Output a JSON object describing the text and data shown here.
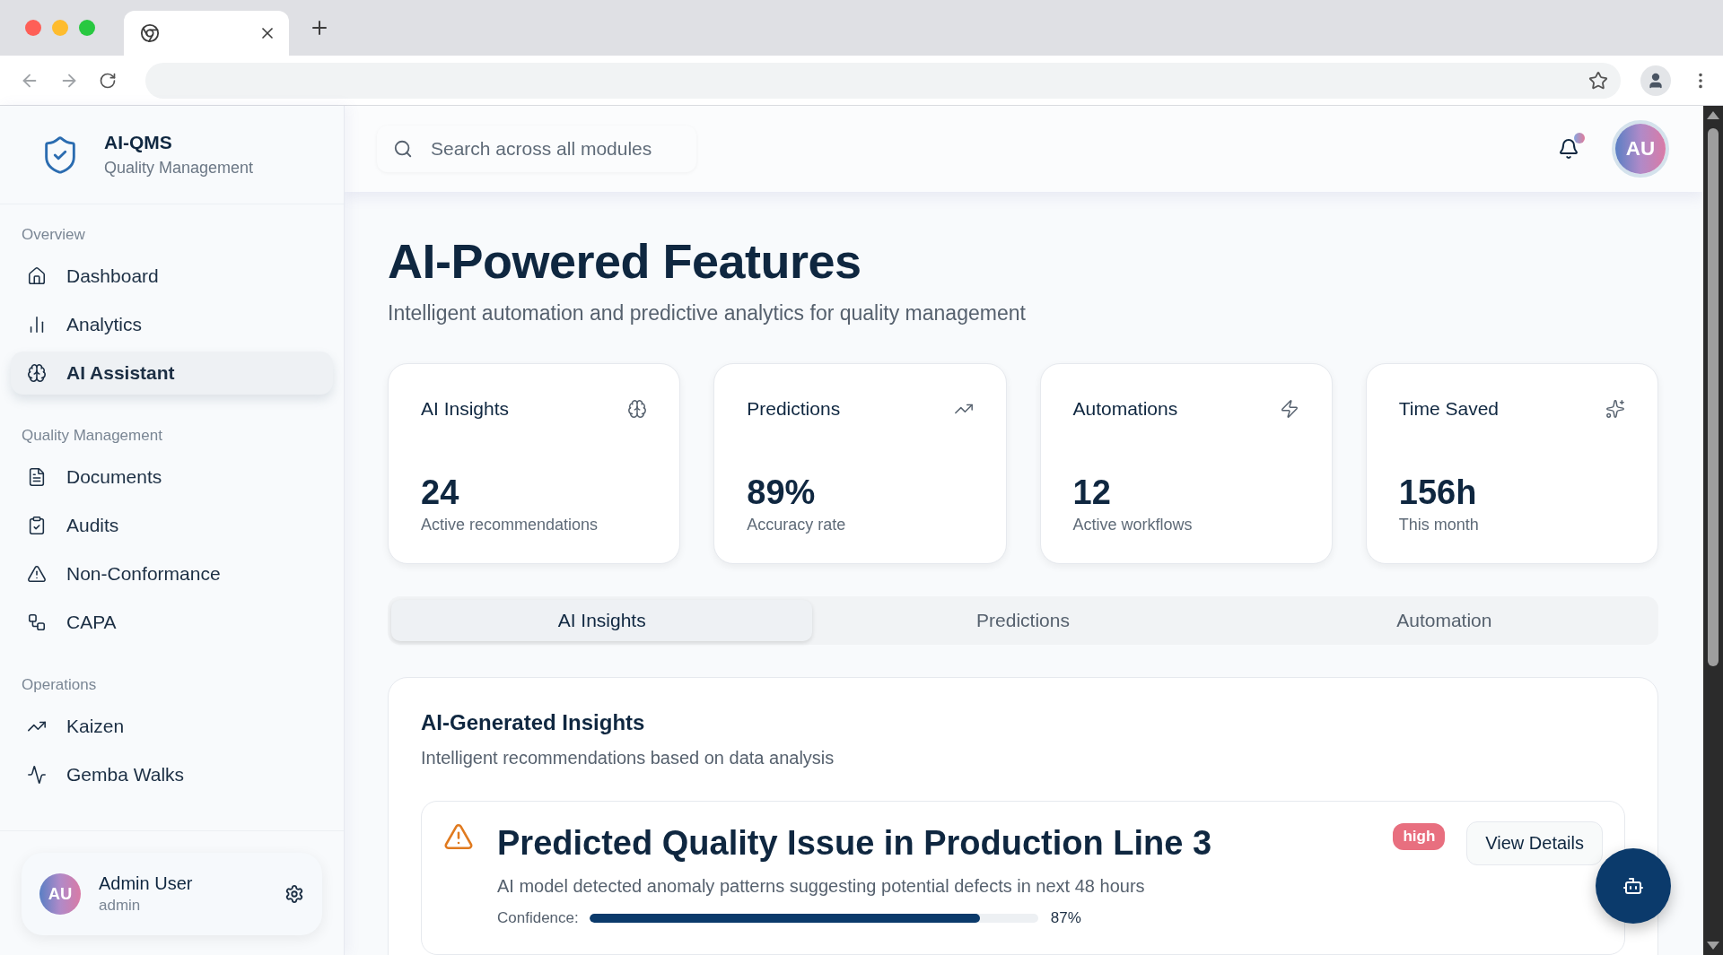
{
  "brand": {
    "name": "AI-QMS",
    "subtitle": "Quality Management"
  },
  "sidebar": {
    "sections": [
      {
        "label": "Overview",
        "items": [
          {
            "label": "Dashboard",
            "selected": false
          },
          {
            "label": "Analytics",
            "selected": false
          },
          {
            "label": "AI Assistant",
            "selected": true
          }
        ]
      },
      {
        "label": "Quality Management",
        "items": [
          {
            "label": "Documents",
            "selected": false
          },
          {
            "label": "Audits",
            "selected": false
          },
          {
            "label": "Non-Conformance",
            "selected": false
          },
          {
            "label": "CAPA",
            "selected": false
          }
        ]
      },
      {
        "label": "Operations",
        "items": [
          {
            "label": "Kaizen",
            "selected": false
          },
          {
            "label": "Gemba Walks",
            "selected": false
          }
        ]
      }
    ],
    "user": {
      "initials": "AU",
      "name": "Admin User",
      "role": "admin"
    }
  },
  "header": {
    "search": {
      "placeholder": "Search across all modules"
    },
    "notifications_unread": true,
    "avatar": "AU"
  },
  "page": {
    "title": "AI-Powered Features",
    "subtitle": "Intelligent automation and predictive analytics for quality management"
  },
  "stats": [
    {
      "title": "AI Insights",
      "value": "24",
      "caption": "Active recommendations"
    },
    {
      "title": "Predictions",
      "value": "89%",
      "caption": "Accuracy rate"
    },
    {
      "title": "Automations",
      "value": "12",
      "caption": "Active workflows"
    },
    {
      "title": "Time Saved",
      "value": "156h",
      "caption": "This month"
    }
  ],
  "tabs": [
    {
      "label": "AI Insights",
      "selected": true
    },
    {
      "label": "Predictions",
      "selected": false
    },
    {
      "label": "Automation",
      "selected": false
    }
  ],
  "insights": {
    "title": "AI-Generated Insights",
    "subtitle": "Intelligent recommendations based on data analysis",
    "items": [
      {
        "title": "Predicted Quality Issue in Production Line 3",
        "description": "AI model detected anomaly patterns suggesting potential defects in next 48 hours",
        "priority": "high",
        "action": "View Details",
        "confidence_label": "Confidence:",
        "level": 0.87,
        "reading": "87%"
      }
    ]
  }
}
